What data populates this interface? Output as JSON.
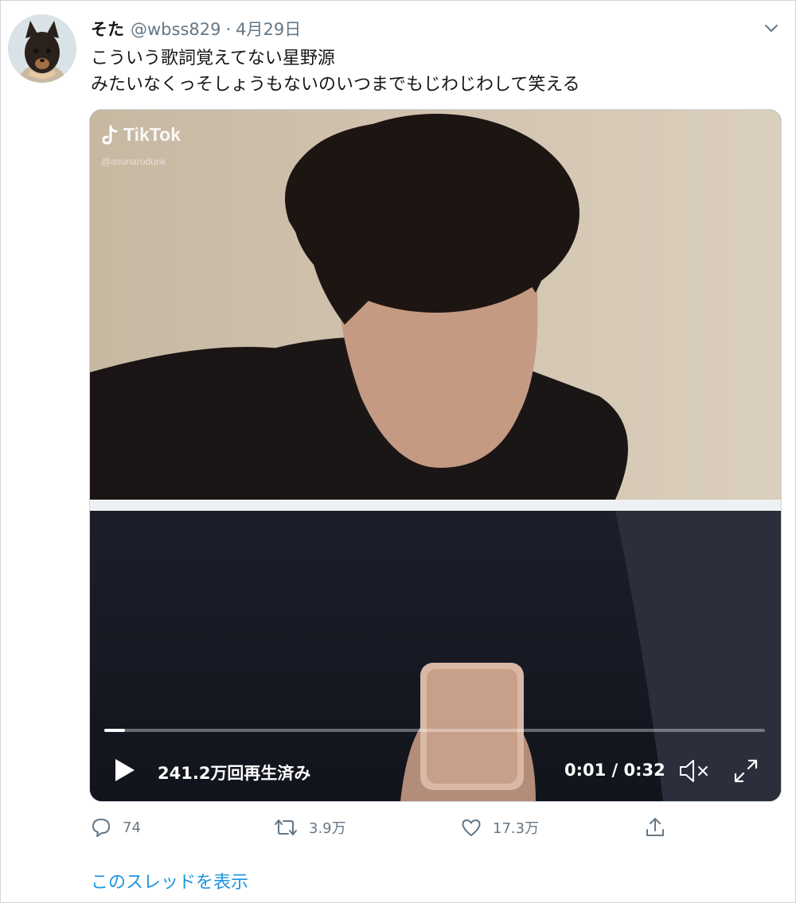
{
  "tweet": {
    "author_name": "そた",
    "author_handle": "@wbss829",
    "separator": "·",
    "date": "4月29日",
    "text_lines": [
      "こういう歌詞覚えてない星野源",
      "みたいなくっそしょうもないのいつまでもじわじわして笑える"
    ]
  },
  "video": {
    "watermark_brand": "TikTok",
    "watermark_user": "@asunarodunk",
    "views": "241.2万回再生済み",
    "timecode": "0:01 / 0:32",
    "progress_fraction": 0.031
  },
  "actions": {
    "reply_count": "74",
    "retweet_count": "3.9万",
    "like_count": "17.3万"
  },
  "thread_link": "このスレッドを表示",
  "colors": {
    "link": "#1b95e0",
    "secondary_text": "#657786",
    "primary_text": "#14171a"
  }
}
